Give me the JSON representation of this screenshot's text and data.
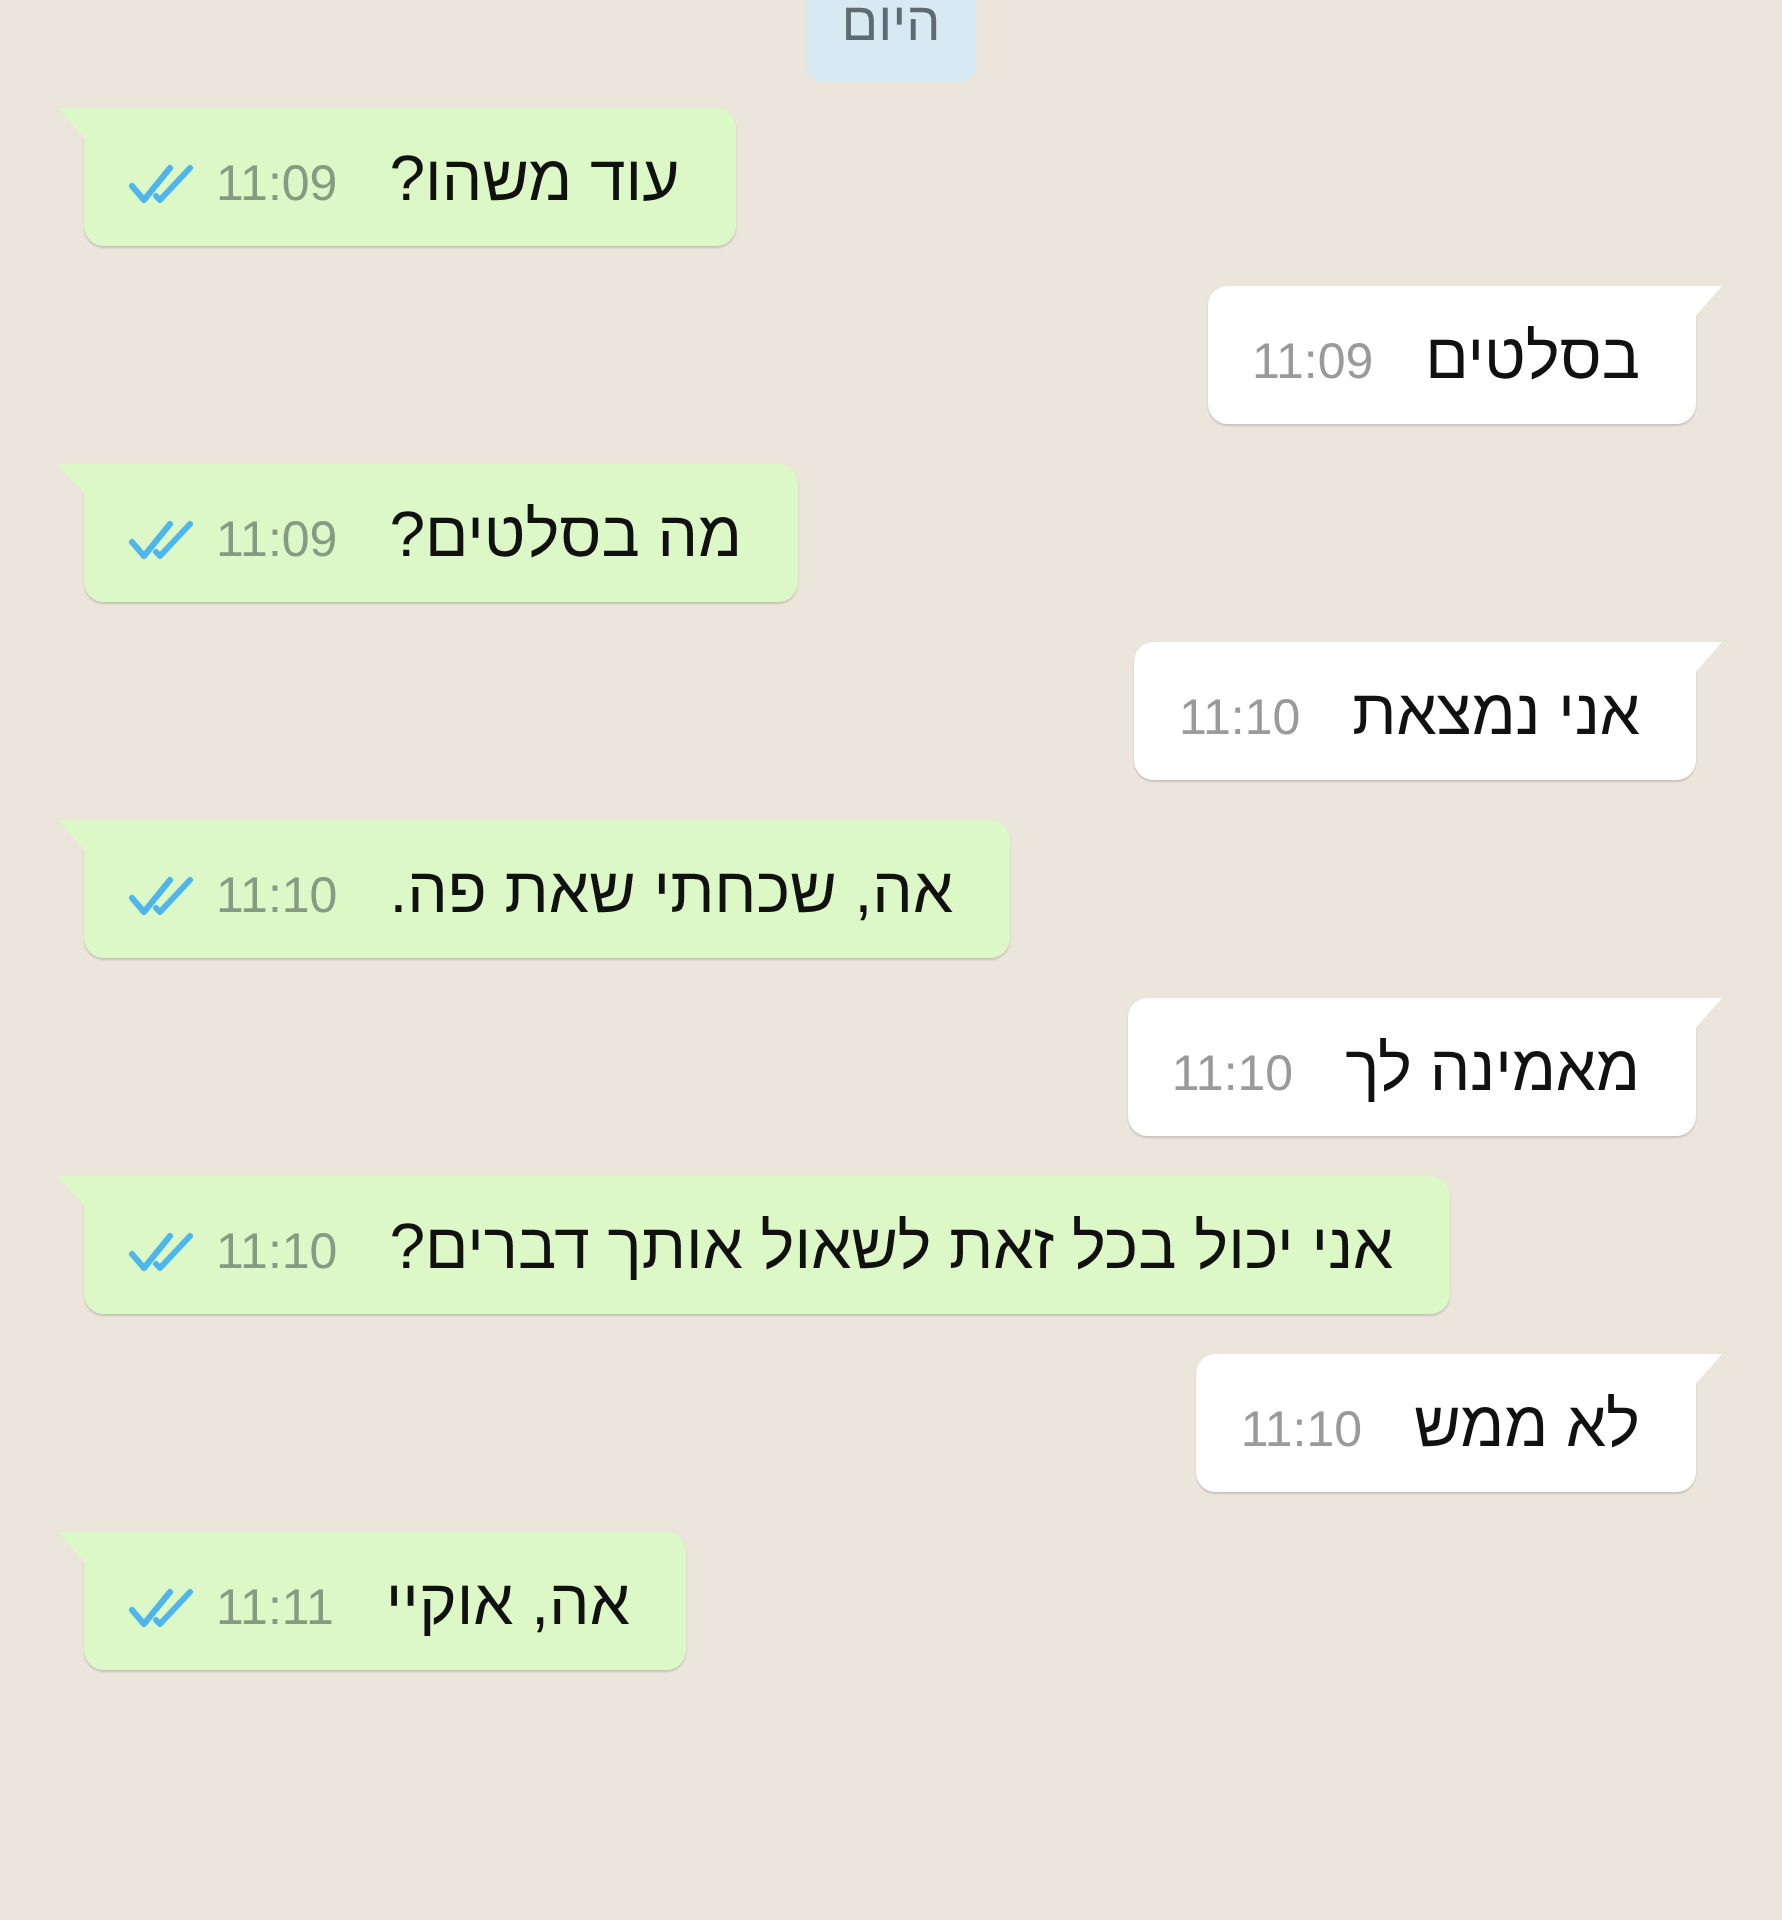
{
  "date_badge": "היום",
  "messages": [
    {
      "kind": "sent",
      "text": "עוד משהו?",
      "time": "11:09",
      "read": true
    },
    {
      "kind": "received",
      "text": "בסלטים",
      "time": "11:09"
    },
    {
      "kind": "sent",
      "text": "מה בסלטים?",
      "time": "11:09",
      "read": true
    },
    {
      "kind": "received",
      "text": "אני נמצאת",
      "time": "11:10"
    },
    {
      "kind": "sent",
      "text": "אה, שכחתי שאת פה.",
      "time": "11:10",
      "read": true
    },
    {
      "kind": "received",
      "text": "מאמינה לך",
      "time": "11:10"
    },
    {
      "kind": "sent",
      "text": "אני יכול בכל זאת לשאול אותך דברים?",
      "time": "11:10",
      "read": true
    },
    {
      "kind": "received",
      "text": "לא ממש",
      "time": "11:10"
    },
    {
      "kind": "sent",
      "text": "אה, אוקיי",
      "time": "11:11",
      "read": true
    }
  ]
}
